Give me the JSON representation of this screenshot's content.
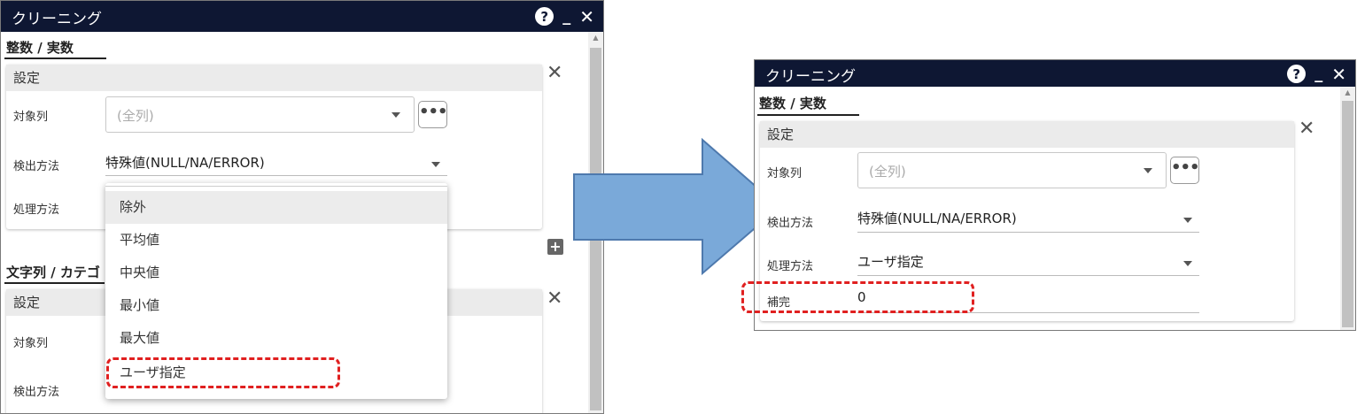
{
  "left": {
    "title": "クリーニング",
    "section1": "整数 / 実数",
    "card_header": "設定",
    "target_col_label": "対象列",
    "target_col_placeholder": "(全列)",
    "detect_label": "検出方法",
    "detect_value": "特殊値(NULL/NA/ERROR)",
    "process_label": "処理方法",
    "section2": "文字列 / カテゴ",
    "card2_header": "設定",
    "target_col_label2": "対象列",
    "detect_label2": "検出方法",
    "dropdown_options": [
      "除外",
      "平均値",
      "中央値",
      "最小値",
      "最大値",
      "ユーザ指定"
    ]
  },
  "right": {
    "title": "クリーニング",
    "section1": "整数 / 実数",
    "card_header": "設定",
    "target_col_label": "対象列",
    "target_col_placeholder": "(全列)",
    "detect_label": "検出方法",
    "detect_value": "特殊値(NULL/NA/ERROR)",
    "process_label": "処理方法",
    "process_value": "ユーザ指定",
    "complement_label": "補完",
    "complement_value": "0"
  },
  "colors": {
    "titlebar": "#0e1733",
    "arrow_fill": "#7aa9d9",
    "arrow_stroke": "#4e79ad",
    "highlight_dash": "#e02020"
  },
  "icons": [
    "help-icon",
    "minimize-icon",
    "close-icon",
    "more-icon",
    "add-icon",
    "chevron-down-icon"
  ]
}
